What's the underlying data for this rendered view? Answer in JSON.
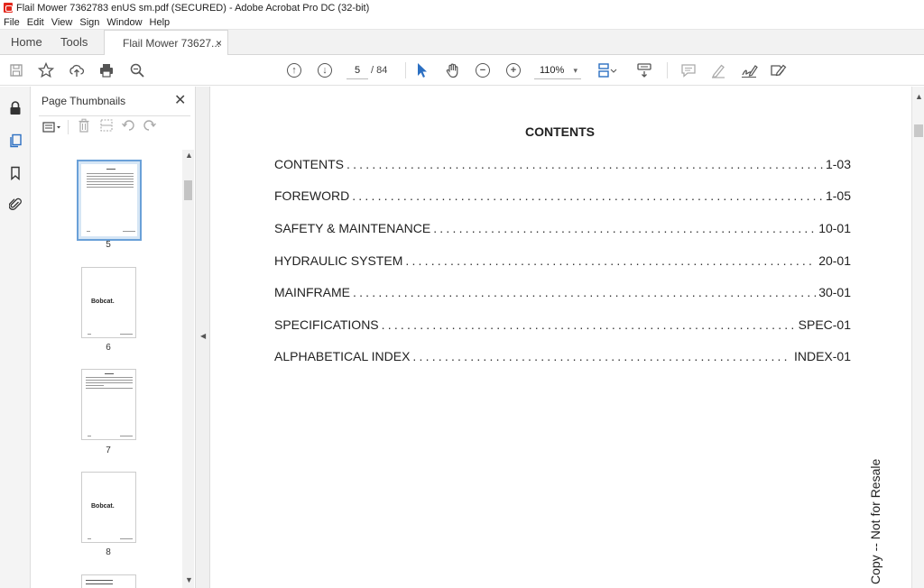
{
  "window": {
    "title": "Flail Mower 7362783 enUS sm.pdf (SECURED) - Adobe Acrobat Pro DC (32-bit)"
  },
  "menu": [
    "File",
    "Edit",
    "View",
    "Sign",
    "Window",
    "Help"
  ],
  "tabs": {
    "home": "Home",
    "tools": "Tools",
    "doc": "Flail Mower 73627...",
    "close": "×"
  },
  "toolbar": {
    "page_current": "5",
    "page_total": "/ 84",
    "zoom": "110%"
  },
  "thumbnails": {
    "title": "Page Thumbnails",
    "close": "✕",
    "pages": [
      {
        "num": "5",
        "selected": true,
        "content": "toc"
      },
      {
        "num": "6",
        "selected": false,
        "content": "logo",
        "logo_text": "Bobcat."
      },
      {
        "num": "7",
        "selected": false,
        "content": "toc"
      },
      {
        "num": "8",
        "selected": false,
        "content": "logo",
        "logo_text": "Bobcat."
      }
    ]
  },
  "document": {
    "heading": "CONTENTS",
    "toc": [
      {
        "label": "CONTENTS",
        "page": "1-03"
      },
      {
        "label": "FOREWORD",
        "page": "1-05"
      },
      {
        "label": "SAFETY & MAINTENANCE",
        "page": "10-01"
      },
      {
        "label": "HYDRAULIC SYSTEM",
        "page": "20-01"
      },
      {
        "label": "MAINFRAME",
        "page": "30-01"
      },
      {
        "label": "SPECIFICATIONS",
        "page": "SPEC-01"
      },
      {
        "label": "ALPHABETICAL INDEX",
        "page": "INDEX-01"
      }
    ],
    "watermark": "Copy -- Not for Resale"
  }
}
